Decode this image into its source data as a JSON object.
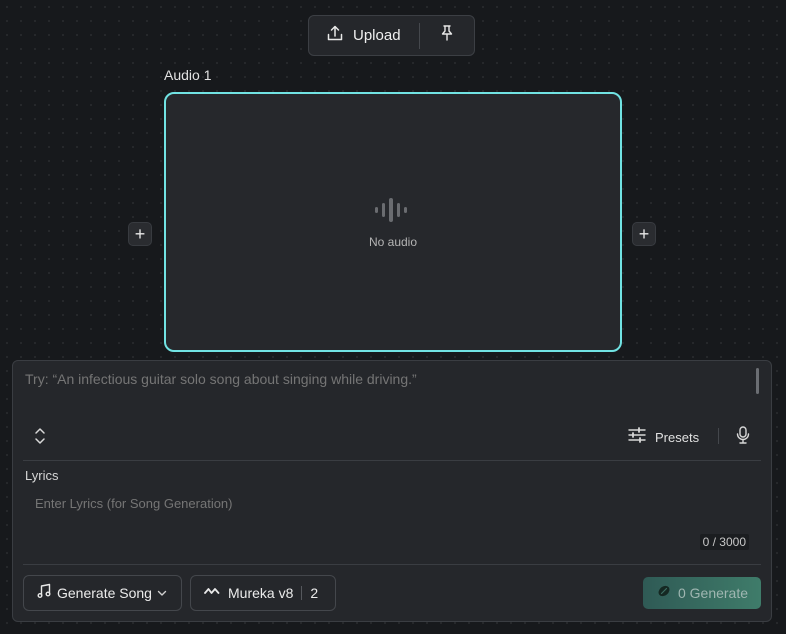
{
  "toolbar": {
    "upload_label": "Upload"
  },
  "audio": {
    "label": "Audio 1",
    "empty_text": "No audio"
  },
  "prompt": {
    "placeholder": "Try: “An infectious guitar solo song about singing while driving.”"
  },
  "controls": {
    "presets_label": "Presets"
  },
  "lyrics": {
    "label": "Lyrics",
    "placeholder": "Enter Lyrics (for Song Generation)",
    "counter": "0 / 3000"
  },
  "footer": {
    "mode_label": "Generate Song",
    "model_label": "Mureka v8",
    "model_count": "2",
    "generate_label": "0 Generate"
  },
  "icons": {
    "upload": "upload-icon",
    "pin": "pin-icon",
    "waveform": "waveform-icon",
    "plus": "plus-icon",
    "expand": "expand-icon",
    "sliders": "sliders-icon",
    "microphone": "microphone-icon",
    "music-note": "music-note-icon",
    "chevron-down": "chevron-down-icon",
    "mureka-logo": "mureka-logo-icon",
    "coin": "coin-icon"
  },
  "colors": {
    "accent_border": "#71e3e3",
    "generate_bg": "#3f7c6a",
    "background": "#17191c",
    "panel": "#25272b"
  }
}
